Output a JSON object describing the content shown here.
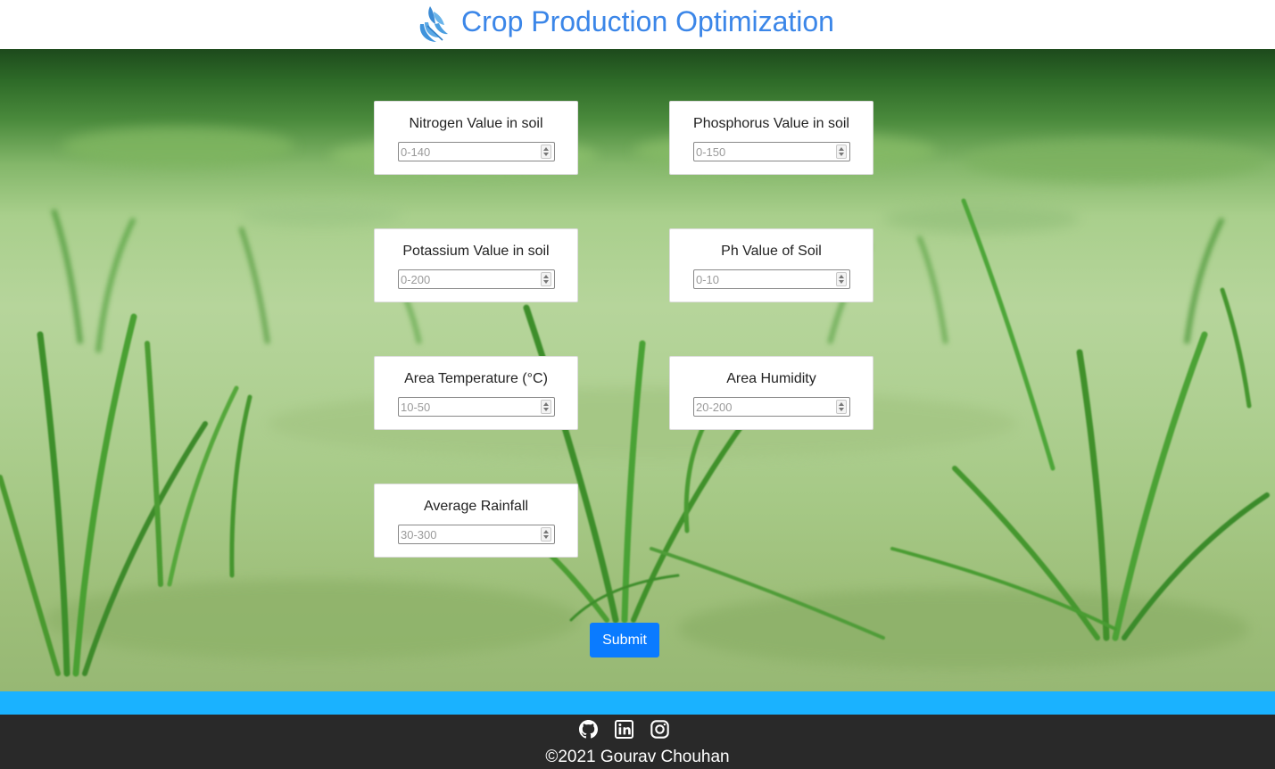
{
  "header": {
    "logo_icon": "wheat-leaf-logo-icon",
    "title": "Crop Production Optimization",
    "title_color": "#3b86e8"
  },
  "form": {
    "fields": [
      {
        "label": "Nitrogen Value in soil",
        "placeholder": "0-140",
        "value": ""
      },
      {
        "label": "Phosphorus Value in soil",
        "placeholder": "0-150",
        "value": ""
      },
      {
        "label": "Potassium Value in soil",
        "placeholder": "0-200",
        "value": ""
      },
      {
        "label": "Ph Value of Soil",
        "placeholder": "0-10",
        "value": ""
      },
      {
        "label": "Area Temperature (°C)",
        "placeholder": "10-50",
        "value": ""
      },
      {
        "label": "Area Humidity",
        "placeholder": "20-200",
        "value": ""
      },
      {
        "label": "Average Rainfall",
        "placeholder": "30-300",
        "value": ""
      }
    ],
    "submit_label": "Submit",
    "submit_color": "#0a7bff"
  },
  "footer": {
    "icons": [
      "github-icon",
      "linkedin-icon",
      "instagram-icon"
    ],
    "copyright": "©2021 Gourav Chouhan",
    "accent_color": "#1ab2ff",
    "background_color": "#292929"
  }
}
